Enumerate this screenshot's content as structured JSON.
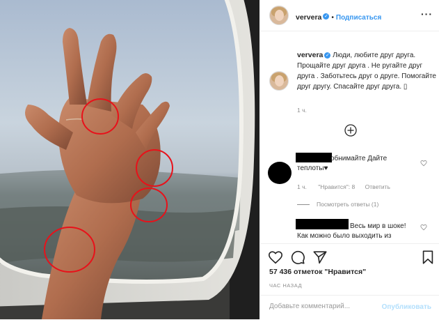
{
  "post": {
    "username": "ververa",
    "follow_label": "Подписаться",
    "more_label": "···"
  },
  "caption": {
    "username": "ververa",
    "text": "Люди, любите друг друга. Прощайте друг друга . Не ругайте друг друга . Заботьтесь друг о друге. Помогайте друг другу. Спасайте друг друга. ▯",
    "time": "1 ч."
  },
  "comments": [
    {
      "text_line1": "обнимайте Дайте",
      "text_line2": "теплоты♥",
      "time": "1 ч.",
      "likes": "\"Нравится\": 8",
      "reply_label": "Ответить"
    },
    {
      "text_line1": "Весь мир в шоке!",
      "text_line2": "Как можно было выходить из"
    }
  ],
  "replies_label": "Посмотреть ответы (1)",
  "likes_count": "57 436 отметок \"Нравится\"",
  "time_ago": "ЧАС НАЗАД",
  "add_comment": {
    "placeholder": "Добавьте комментарий...",
    "publish_label": "Опубликовать"
  },
  "colors": {
    "accent": "#3897f0",
    "annotation_red": "#e8111a",
    "publish_disabled": "#b2dffc"
  },
  "icons": [
    "verified-icon",
    "more-icon",
    "add-icon",
    "heart-icon",
    "comment-icon",
    "share-icon",
    "bookmark-icon"
  ]
}
